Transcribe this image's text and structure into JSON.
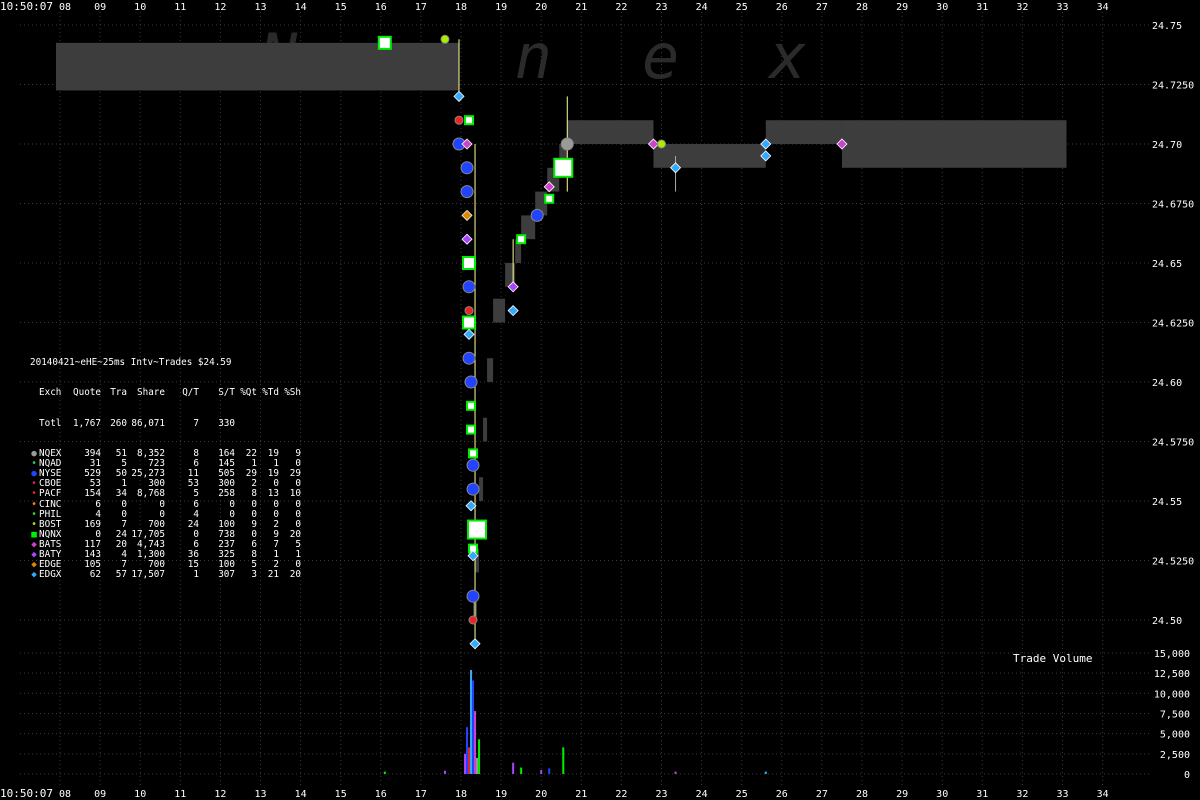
{
  "watermark": "Nanex",
  "time_label_left": "10:50:07",
  "x_ticks": [
    "08",
    "09",
    "10",
    "11",
    "12",
    "13",
    "14",
    "15",
    "16",
    "17",
    "18",
    "19",
    "20",
    "21",
    "22",
    "23",
    "24",
    "25",
    "26",
    "27",
    "28",
    "29",
    "30",
    "31",
    "32",
    "33",
    "34"
  ],
  "price_ticks": [
    "24.75",
    "24.7250",
    "24.70",
    "24.6750",
    "24.65",
    "24.6250",
    "24.60",
    "24.5750",
    "24.55",
    "24.5250",
    "24.50"
  ],
  "volume_ticks": [
    "15,000",
    "12,500",
    "10,000",
    "7,500",
    "5,000",
    "2,500",
    "0"
  ],
  "volume_title": "Trade Volume",
  "stats": {
    "header_title": "20140421~eHE~25ms Intv~Trades $24.59",
    "columns": [
      "Exch",
      "Quote",
      "Tra",
      "Share",
      "Q/T",
      "S/T",
      "%Qt",
      "%Td",
      "%Sh"
    ],
    "total": {
      "exch": "Totl",
      "quote": "1,767",
      "tra": "260",
      "share": "86,071",
      "qt": "7",
      "st": "330",
      "pq": "",
      "pt": "",
      "ps": ""
    },
    "rows": [
      {
        "exch": "NQEX",
        "quote": "394",
        "tra": "51",
        "share": "8,352",
        "qt": "8",
        "st": "164",
        "pq": "22",
        "pt": "19",
        "ps": "9",
        "color": "#9a9a9a",
        "marker": "circle-lg"
      },
      {
        "exch": "NQAD",
        "quote": "31",
        "tra": "5",
        "share": "723",
        "qt": "6",
        "st": "145",
        "pq": "1",
        "pt": "1",
        "ps": "0",
        "color": "#22cc66",
        "marker": "circle-sm"
      },
      {
        "exch": "NYSE",
        "quote": "529",
        "tra": "50",
        "share": "25,273",
        "qt": "11",
        "st": "505",
        "pq": "29",
        "pt": "19",
        "ps": "29",
        "color": "#2244ff",
        "marker": "circle-lg"
      },
      {
        "exch": "CBOE",
        "quote": "53",
        "tra": "1",
        "share": "300",
        "qt": "53",
        "st": "300",
        "pq": "2",
        "pt": "0",
        "ps": "0",
        "color": "#cc2266",
        "marker": "circle-sm"
      },
      {
        "exch": "PACF",
        "quote": "154",
        "tra": "34",
        "share": "8,768",
        "qt": "5",
        "st": "258",
        "pq": "8",
        "pt": "13",
        "ps": "10",
        "color": "#ee2222",
        "marker": "circle-sm"
      },
      {
        "exch": "CINC",
        "quote": "6",
        "tra": "0",
        "share": "0",
        "qt": "6",
        "st": "0",
        "pq": "0",
        "pt": "0",
        "ps": "0",
        "color": "#ff8800",
        "marker": "circle-sm"
      },
      {
        "exch": "PHIL",
        "quote": "4",
        "tra": "0",
        "share": "0",
        "qt": "4",
        "st": "0",
        "pq": "0",
        "pt": "0",
        "ps": "0",
        "color": "#33cc33",
        "marker": "circle-sm"
      },
      {
        "exch": "BOST",
        "quote": "169",
        "tra": "7",
        "share": "700",
        "qt": "24",
        "st": "100",
        "pq": "9",
        "pt": "2",
        "ps": "0",
        "color": "#aaee00",
        "marker": "circle-sm"
      },
      {
        "exch": "NQNX",
        "quote": "0",
        "tra": "24",
        "share": "17,705",
        "qt": "0",
        "st": "738",
        "pq": "0",
        "pt": "9",
        "ps": "20",
        "color": "#00ee00",
        "marker": "square"
      },
      {
        "exch": "BATS",
        "quote": "117",
        "tra": "20",
        "share": "4,743",
        "qt": "6",
        "st": "237",
        "pq": "6",
        "pt": "7",
        "ps": "5",
        "color": "#cc44cc",
        "marker": "diamond"
      },
      {
        "exch": "BATY",
        "quote": "143",
        "tra": "4",
        "share": "1,300",
        "qt": "36",
        "st": "325",
        "pq": "8",
        "pt": "1",
        "ps": "1",
        "color": "#aa44ff",
        "marker": "diamond"
      },
      {
        "exch": "EDGE",
        "quote": "105",
        "tra": "7",
        "share": "700",
        "qt": "15",
        "st": "100",
        "pq": "5",
        "pt": "2",
        "ps": "0",
        "color": "#dd8800",
        "marker": "diamond"
      },
      {
        "exch": "EDGX",
        "quote": "62",
        "tra": "57",
        "share": "17,507",
        "qt": "1",
        "st": "307",
        "pq": "3",
        "pt": "21",
        "ps": "20",
        "color": "#33aaff",
        "marker": "diamond"
      }
    ]
  },
  "chart_data": {
    "type": "scatter",
    "x_ticks": [
      8,
      9,
      10,
      11,
      12,
      13,
      14,
      15,
      16,
      17,
      18,
      19,
      20,
      21,
      22,
      23,
      24,
      25,
      26,
      27,
      28,
      29,
      30,
      31,
      32,
      33,
      34
    ],
    "price_axis": {
      "ylim": [
        24.5,
        24.75
      ],
      "ticks": [
        24.75,
        24.725,
        24.7,
        24.675,
        24.65,
        24.625,
        24.6,
        24.575,
        24.55,
        24.525,
        24.5
      ]
    },
    "volume_axis": {
      "ylim": [
        0,
        15000
      ],
      "ticks": [
        15000,
        12500,
        10000,
        7500,
        5000,
        2500,
        0
      ]
    },
    "nbbo_spread_bands": [
      {
        "x0": 7.9,
        "x1": 17.95,
        "bid": 24.7225,
        "ask": 24.7425
      },
      {
        "x0": 20.65,
        "x1": 22.8,
        "bid": 24.7,
        "ask": 24.71
      },
      {
        "x0": 22.8,
        "x1": 25.6,
        "bid": 24.69,
        "ask": 24.7
      },
      {
        "x0": 25.6,
        "x1": 27.5,
        "bid": 24.7,
        "ask": 24.71
      },
      {
        "x0": 27.5,
        "x1": 33.1,
        "bid": 24.69,
        "ask": 24.71
      }
    ],
    "trades": [
      {
        "x": 16.1,
        "price": 24.7425,
        "exchange": "NQNX",
        "size": "lg"
      },
      {
        "x": 17.6,
        "price": 24.744,
        "exchange": "BOST"
      },
      {
        "x": 17.95,
        "price": 24.72,
        "exchange": "EDGX"
      },
      {
        "x": 17.95,
        "price": 24.71,
        "exchange": "PACF"
      },
      {
        "x": 18.2,
        "price": 24.71,
        "exchange": "NQNX"
      },
      {
        "x": 17.95,
        "price": 24.7,
        "exchange": "NYSE"
      },
      {
        "x": 18.15,
        "price": 24.7,
        "exchange": "BATS"
      },
      {
        "x": 18.15,
        "price": 24.69,
        "exchange": "NYSE"
      },
      {
        "x": 18.15,
        "price": 24.68,
        "exchange": "NYSE"
      },
      {
        "x": 18.15,
        "price": 24.67,
        "exchange": "EDGE"
      },
      {
        "x": 18.15,
        "price": 24.66,
        "exchange": "BATY"
      },
      {
        "x": 18.2,
        "price": 24.65,
        "exchange": "NQNX",
        "size": "lg"
      },
      {
        "x": 18.2,
        "price": 24.64,
        "exchange": "NYSE"
      },
      {
        "x": 18.2,
        "price": 24.63,
        "exchange": "PACF"
      },
      {
        "x": 18.2,
        "price": 24.625,
        "exchange": "NQNX",
        "size": "lg"
      },
      {
        "x": 18.2,
        "price": 24.62,
        "exchange": "EDGX"
      },
      {
        "x": 18.2,
        "price": 24.61,
        "exchange": "NYSE"
      },
      {
        "x": 18.25,
        "price": 24.6,
        "exchange": "NYSE",
        "size": "lg"
      },
      {
        "x": 18.25,
        "price": 24.59,
        "exchange": "NQNX"
      },
      {
        "x": 18.25,
        "price": 24.58,
        "exchange": "NQNX"
      },
      {
        "x": 18.3,
        "price": 24.57,
        "exchange": "NQNX"
      },
      {
        "x": 18.3,
        "price": 24.565,
        "exchange": "NYSE"
      },
      {
        "x": 18.3,
        "price": 24.555,
        "exchange": "NYSE"
      },
      {
        "x": 18.25,
        "price": 24.548,
        "exchange": "EDGX"
      },
      {
        "x": 18.4,
        "price": 24.538,
        "exchange": "NQNX",
        "size": "xl"
      },
      {
        "x": 18.3,
        "price": 24.53,
        "exchange": "NQNX"
      },
      {
        "x": 18.3,
        "price": 24.527,
        "exchange": "EDGX"
      },
      {
        "x": 18.3,
        "price": 24.51,
        "exchange": "NYSE"
      },
      {
        "x": 18.3,
        "price": 24.5,
        "exchange": "PACF"
      },
      {
        "x": 18.35,
        "price": 24.49,
        "exchange": "EDGX"
      },
      {
        "x": 19.3,
        "price": 24.64,
        "exchange": "BATY"
      },
      {
        "x": 19.3,
        "price": 24.63,
        "exchange": "EDGX"
      },
      {
        "x": 19.5,
        "price": 24.66,
        "exchange": "NQNX"
      },
      {
        "x": 19.9,
        "price": 24.67,
        "exchange": "NYSE"
      },
      {
        "x": 20.2,
        "price": 24.677,
        "exchange": "NQNX"
      },
      {
        "x": 20.2,
        "price": 24.682,
        "exchange": "BATS"
      },
      {
        "x": 20.55,
        "price": 24.69,
        "exchange": "NQNX",
        "size": "xl"
      },
      {
        "x": 20.65,
        "price": 24.7,
        "exchange": "NQEX"
      },
      {
        "x": 22.8,
        "price": 24.7,
        "exchange": "BATS"
      },
      {
        "x": 23.0,
        "price": 24.7,
        "exchange": "BOST"
      },
      {
        "x": 23.35,
        "price": 24.69,
        "exchange": "EDGX"
      },
      {
        "x": 25.6,
        "price": 24.7,
        "exchange": "EDGX"
      },
      {
        "x": 25.6,
        "price": 24.695,
        "exchange": "EDGX"
      },
      {
        "x": 27.5,
        "price": 24.7,
        "exchange": "BATS"
      }
    ],
    "volume_bars": [
      {
        "x": 16.1,
        "v": 300,
        "exchange": "NQNX"
      },
      {
        "x": 17.6,
        "v": 400,
        "exchange": "BATY"
      },
      {
        "x": 18.1,
        "v": 2500,
        "exchange": "BATY"
      },
      {
        "x": 18.15,
        "v": 5800,
        "exchange": "NYSE"
      },
      {
        "x": 18.2,
        "v": 3300,
        "exchange": "PACF"
      },
      {
        "x": 18.25,
        "v": 12900,
        "exchange": "EDGX"
      },
      {
        "x": 18.3,
        "v": 11600,
        "exchange": "NYSE"
      },
      {
        "x": 18.35,
        "v": 7800,
        "exchange": "BATS"
      },
      {
        "x": 18.4,
        "v": 2000,
        "exchange": "NQEX"
      },
      {
        "x": 18.45,
        "v": 4300,
        "exchange": "NQNX"
      },
      {
        "x": 19.3,
        "v": 1400,
        "exchange": "BATY"
      },
      {
        "x": 19.5,
        "v": 800,
        "exchange": "NQNX"
      },
      {
        "x": 20.0,
        "v": 500,
        "exchange": "BATY"
      },
      {
        "x": 20.2,
        "v": 700,
        "exchange": "NYSE"
      },
      {
        "x": 20.55,
        "v": 3300,
        "exchange": "NQNX"
      },
      {
        "x": 23.35,
        "v": 300,
        "exchange": "BATS"
      },
      {
        "x": 25.6,
        "v": 300,
        "exchange": "EDGX"
      }
    ]
  }
}
